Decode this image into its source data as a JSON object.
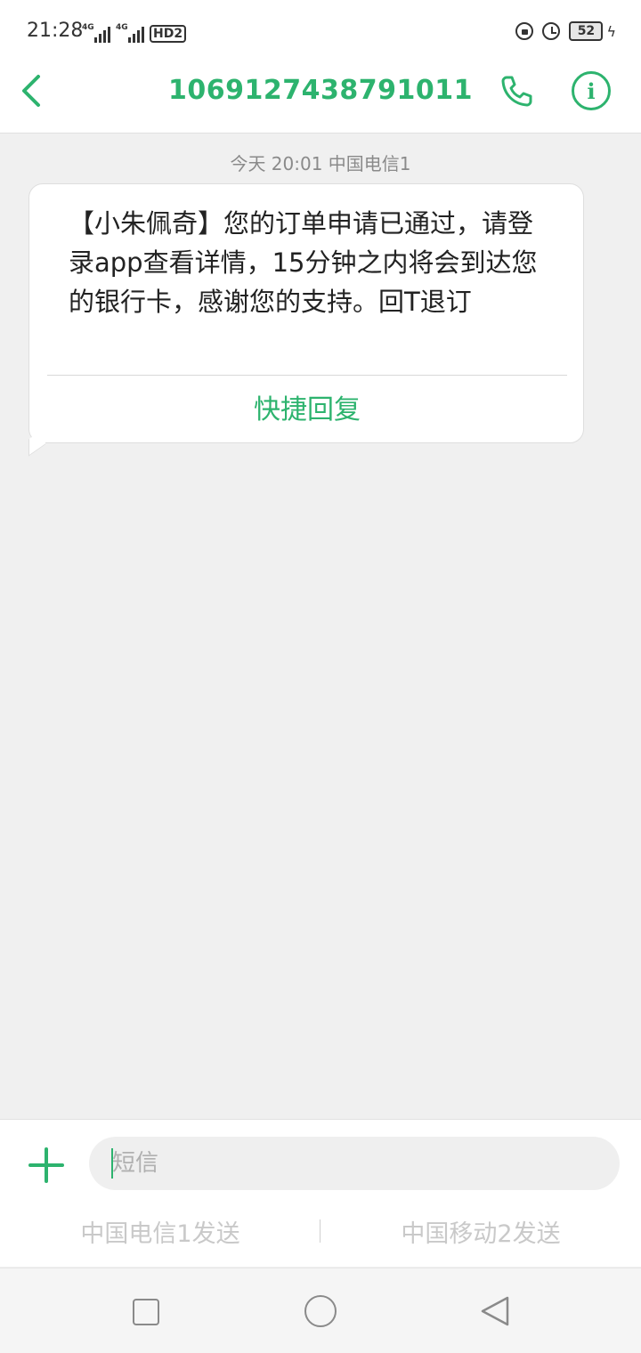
{
  "status_bar": {
    "time": "21:28",
    "network_1": "4G",
    "network_2": "4G",
    "hd_label": "HD2",
    "battery_level": "52"
  },
  "header": {
    "title": "1069127438791011"
  },
  "conversation": {
    "meta": "今天 20:01  中国电信1",
    "message_text": "【小朱佩奇】您的订单申请已通过，请登录app查看详情，15分钟之内将会到达您的银行卡，感谢您的支持。回T退订",
    "quick_reply_label": "快捷回复"
  },
  "composer": {
    "placeholder": "短信",
    "send_sim1_label": "中国电信1发送",
    "send_sim2_label": "中国移动2发送"
  },
  "colors": {
    "accent": "#2db36e",
    "background": "#f0f0f0"
  }
}
